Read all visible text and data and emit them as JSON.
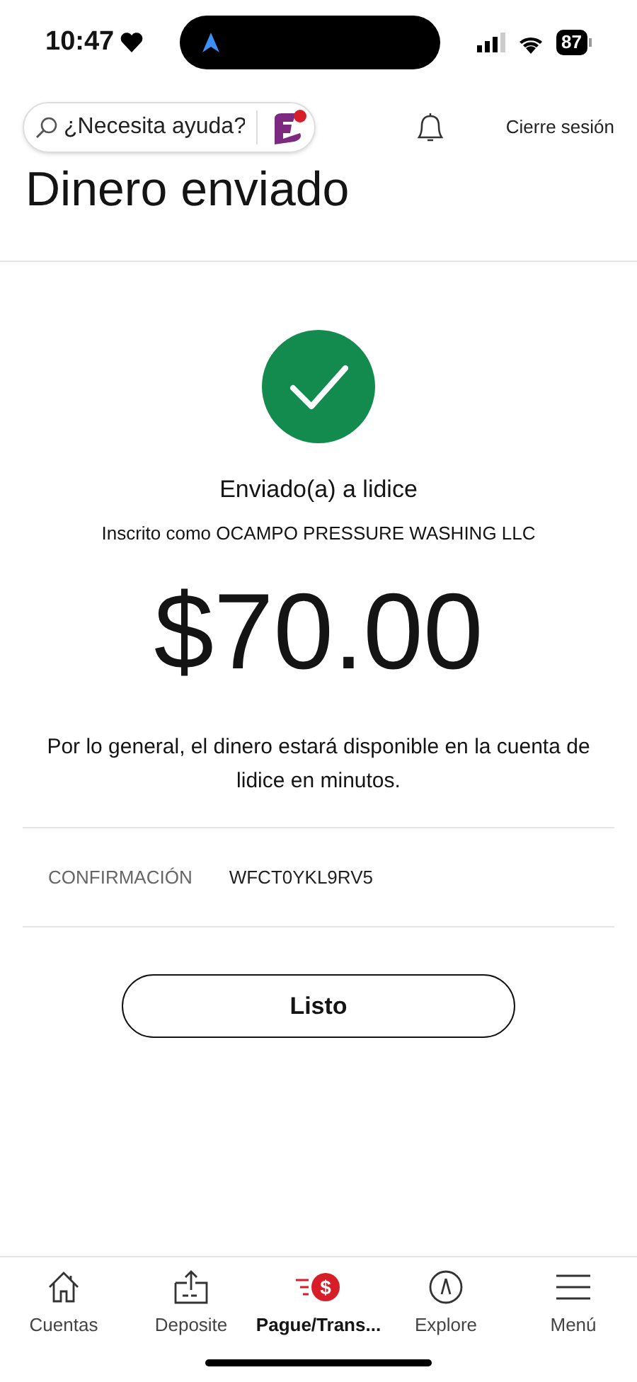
{
  "status_bar": {
    "time": "10:47",
    "battery": "87"
  },
  "header": {
    "search": {
      "placeholder": "¿Necesita ayuda?"
    },
    "logout": "Cierre sesión"
  },
  "title": "Dinero enviado",
  "result": {
    "recipient": "Enviado(a) a lidice",
    "enrolled_as": "Inscrito como OCAMPO PRESSURE WASHING LLC",
    "amount": "$70.00",
    "note": "Por lo general, el dinero estará disponible en la cuenta de lidice en minutos."
  },
  "confirmation": {
    "label": "CONFIRMACIÓN",
    "value": "WFCT0YKL9RV5"
  },
  "done_button": "Listo",
  "nav": [
    {
      "label": "Cuentas",
      "kind": "home",
      "selected": false
    },
    {
      "label": "Deposite",
      "kind": "deposit",
      "selected": false
    },
    {
      "label": "Pague/Trans...",
      "kind": "pay",
      "icon_text": "$",
      "selected": true
    },
    {
      "label": "Explore",
      "kind": "explore",
      "selected": false
    },
    {
      "label": "Menú",
      "kind": "menu",
      "selected": false
    }
  ]
}
